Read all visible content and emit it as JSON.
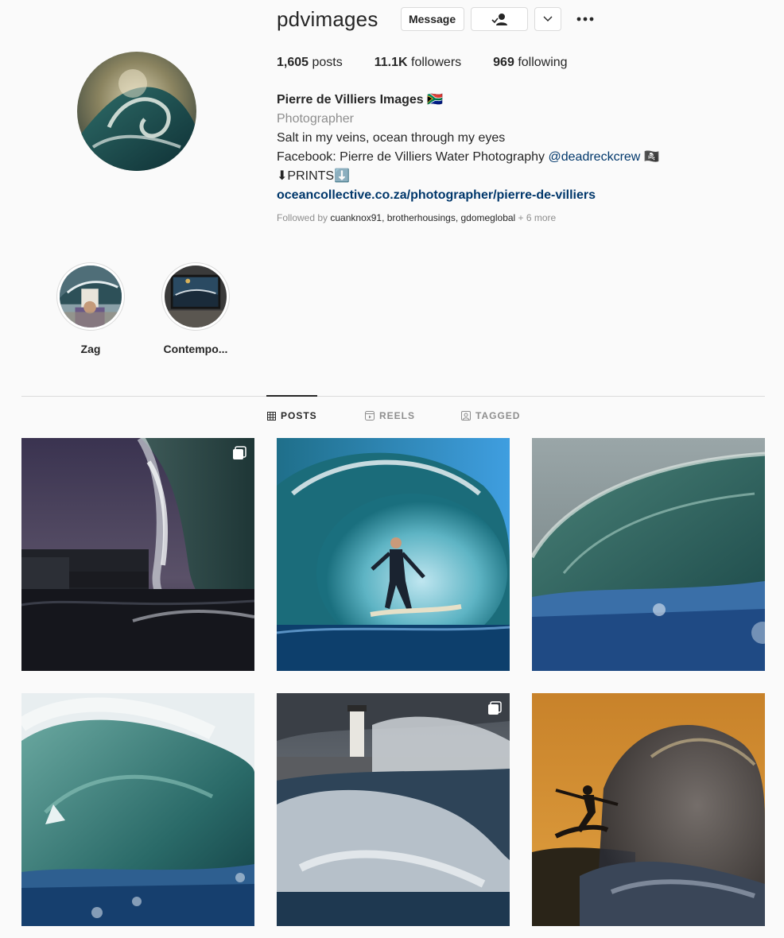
{
  "profile": {
    "username": "pdvimages",
    "message_label": "Message",
    "stats": {
      "posts_count": "1,605",
      "posts_label": "posts",
      "followers_count": "11.1K",
      "followers_label": "followers",
      "following_count": "969",
      "following_label": "following"
    },
    "bio": {
      "name": "Pierre de Villiers Images 🇿🇦",
      "category": "Photographer",
      "line1": "Salt in my veins, ocean through my eyes",
      "line2_prefix": "Facebook: Pierre de Villiers Water Photography ",
      "line2_mention": "@deadreckcrew",
      "line2_suffix": " 🏴‍☠️",
      "line3": "⬇PRINTS⬇️",
      "link": "oceancollective.co.za/photographer/pierre-de-villiers"
    },
    "followed_by": {
      "prefix": "Followed by ",
      "users": "cuanknox91, brotherhousings, gdomeglobal",
      "more": " + 6 more"
    }
  },
  "highlights": [
    {
      "label": "Zag"
    },
    {
      "label": "Contempo..."
    }
  ],
  "tabs": [
    {
      "label": "POSTS",
      "active": true
    },
    {
      "label": "REELS",
      "active": false
    },
    {
      "label": "TAGGED",
      "active": false
    }
  ],
  "posts": [
    {
      "subject": "dark barrel wave with pier at dusk",
      "multi": true
    },
    {
      "subject": "surfer in blue barrel",
      "multi": false
    },
    {
      "subject": "green breaking wave lip",
      "multi": false
    },
    {
      "subject": "teal wave barrel with sparkles",
      "multi": false
    },
    {
      "subject": "lighthouse with crashing waves",
      "multi": true
    },
    {
      "subject": "surfer silhouette at golden hour",
      "multi": false
    }
  ],
  "colors": {
    "link": "#00376b",
    "muted": "#8e8e8e",
    "text": "#262626",
    "border": "#dbdbdb"
  }
}
